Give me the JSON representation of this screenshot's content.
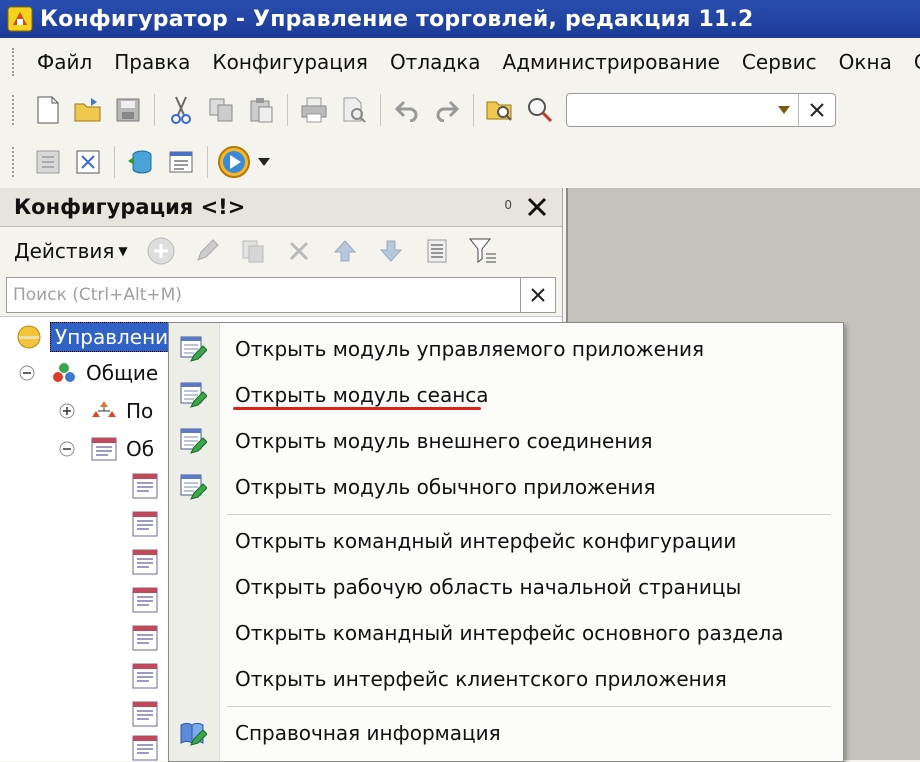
{
  "window": {
    "title": "Конфигуратор - Управление торговлей, редакция 11.2"
  },
  "menu": {
    "items": [
      "Файл",
      "Правка",
      "Конфигурация",
      "Отладка",
      "Администрирование",
      "Сервис",
      "Окна",
      "С"
    ]
  },
  "toolbar": {
    "search_value": ""
  },
  "panel": {
    "title": "Конфигурация <!>",
    "badge": "0",
    "actions_label": "Действия",
    "search_placeholder": "Поиск (Ctrl+Alt+M)"
  },
  "tree": {
    "root_label": "Управлени",
    "general_label": "Общие",
    "subsystems_label": "По",
    "common_modules_label": "Об"
  },
  "context_menu": {
    "items": [
      "Открыть модуль управляемого приложения",
      "Открыть модуль сеанса",
      "Открыть модуль внешнего соединения",
      "Открыть модуль обычного приложения",
      "Открыть командный интерфейс конфигурации",
      "Открыть рабочую область начальной страницы",
      "Открыть командный интерфейс основного раздела",
      "Открыть интерфейс клиентского приложения",
      "Справочная информация"
    ],
    "highlight_color": "#e0201a"
  }
}
